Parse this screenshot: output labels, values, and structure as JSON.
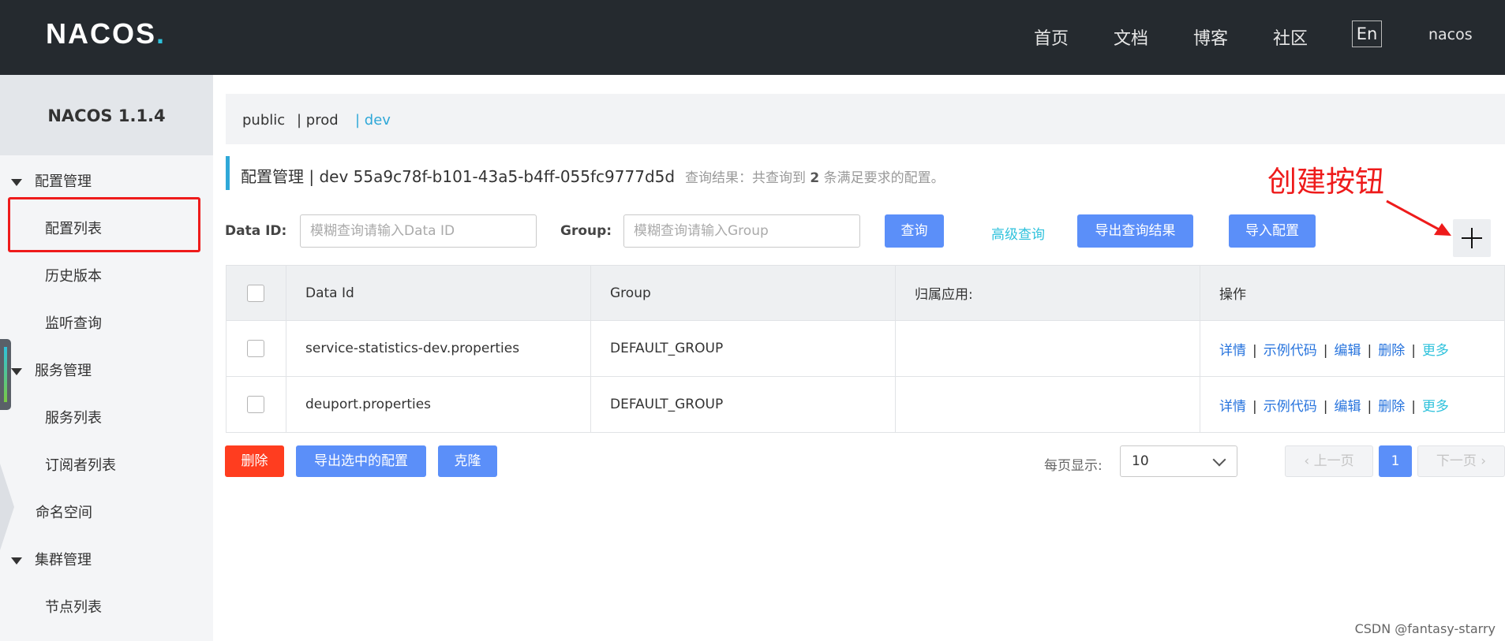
{
  "header": {
    "logo": "NACOS",
    "logo_dot": ".",
    "nav": [
      "首页",
      "文档",
      "博客",
      "社区"
    ],
    "lang": "En",
    "user": "nacos"
  },
  "sidebar": {
    "version": "NACOS 1.1.4",
    "groups": [
      {
        "label": "配置管理",
        "items": [
          "配置列表",
          "历史版本",
          "监听查询"
        ]
      },
      {
        "label": "服务管理",
        "items": [
          "服务列表",
          "订阅者列表"
        ]
      },
      {
        "label": "命名空间",
        "items": []
      },
      {
        "label": "集群管理",
        "items": [
          "节点列表"
        ]
      }
    ],
    "active_item": "配置列表"
  },
  "namespaces": [
    "public",
    "| prod",
    "| dev"
  ],
  "active_namespace": "dev",
  "title": {
    "text": "配置管理 | dev 55a9c78f-b101-43a5-b4ff-055fc9777d5d",
    "result_prefix": "查询结果：共查询到",
    "result_count": "2",
    "result_suffix": "条满足要求的配置。"
  },
  "annotation": "创建按钮",
  "search": {
    "dataid_label": "Data ID:",
    "dataid_placeholder": "模糊查询请输入Data ID",
    "group_label": "Group:",
    "group_placeholder": "模糊查询请输入Group",
    "query_button": "查询",
    "advanced_link": "高级查询",
    "export_button": "导出查询结果",
    "import_button": "导入配置"
  },
  "table": {
    "columns": [
      "Data Id",
      "Group",
      "归属应用:",
      "操作"
    ],
    "rows": [
      {
        "data_id": "service-statistics-dev.properties",
        "group": "DEFAULT_GROUP",
        "app": ""
      },
      {
        "data_id": "deuport.properties",
        "group": "DEFAULT_GROUP",
        "app": ""
      }
    ],
    "actions": [
      "详情",
      "示例代码",
      "编辑",
      "删除",
      "更多"
    ]
  },
  "footer": {
    "delete_button": "删除",
    "export_selected_button": "导出选中的配置",
    "clone_button": "克隆",
    "per_page_label": "每页显示:",
    "per_page_value": "10",
    "prev": "上一页",
    "current_page": "1",
    "next": "下一页"
  },
  "watermark": "CSDN @fantasy-starry",
  "colors": {
    "accent": "#5b8ff9",
    "danger": "#ff3d1f",
    "link": "#2673dd",
    "teal": "#2fc2dc",
    "annotation": "#ee1b1b"
  }
}
